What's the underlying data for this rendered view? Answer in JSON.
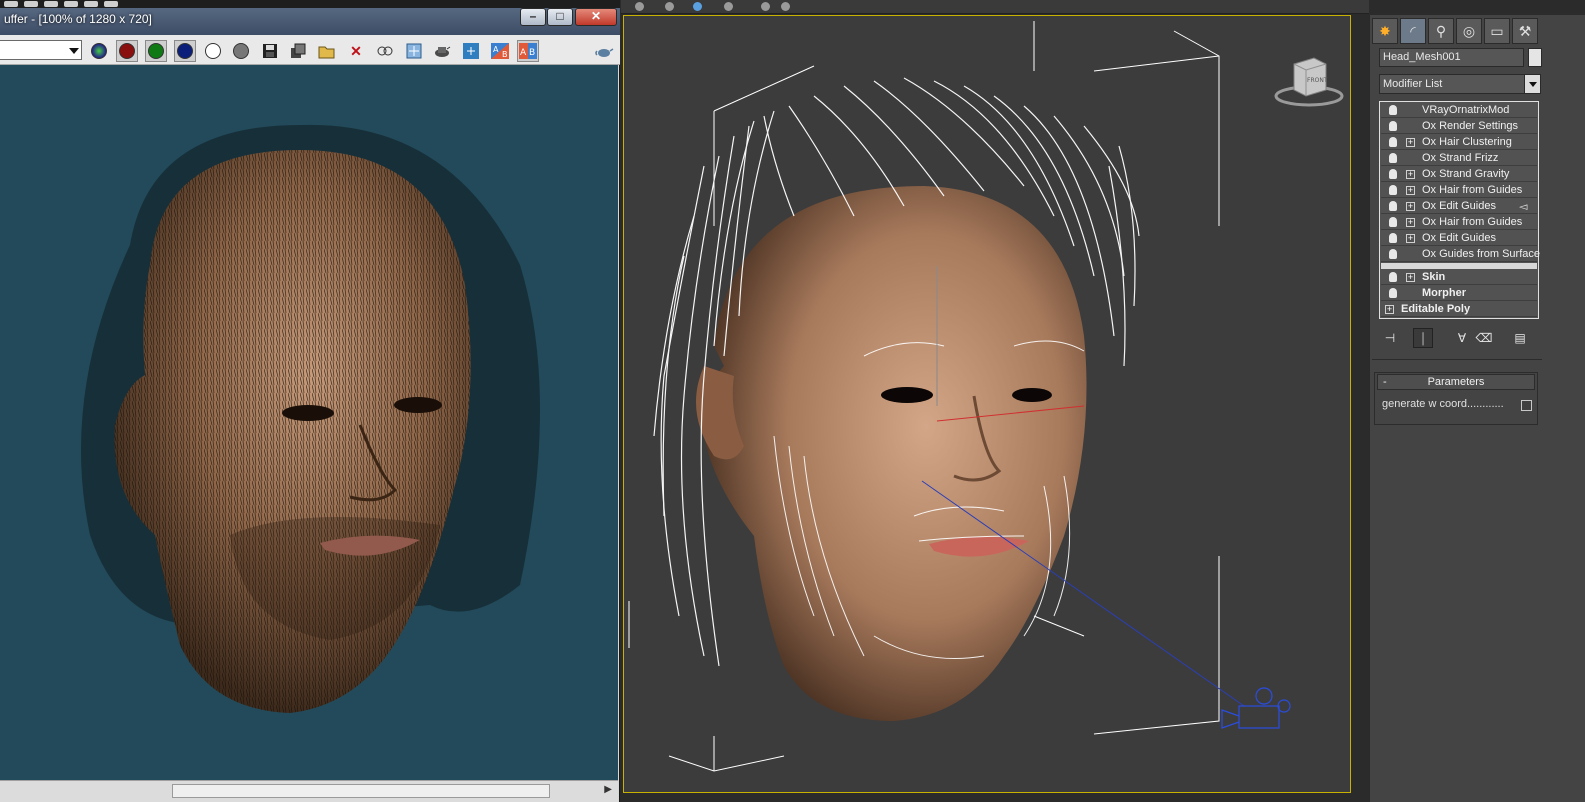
{
  "vfb": {
    "title": "uffer - [100% of 1280 x 720]",
    "window_buttons": {
      "minimize": "–",
      "maximize": "□",
      "close": "✕"
    },
    "toolbar": {
      "channel_value": "",
      "icons": [
        "red-channel-icon",
        "green-channel-icon",
        "blue-channel-icon",
        "alpha-channel-icon",
        "mono-icon",
        "save-icon",
        "duplicate-icon",
        "open-icon",
        "clear-icon",
        "track-mouse-icon",
        "region-render-icon",
        "render-icon",
        "lut-icon",
        "ab-compare-icon",
        "ab-toggle-icon",
        "teapot-icon"
      ]
    },
    "colors": {
      "background": "#224a5a"
    }
  },
  "viewport": {
    "viewcube_label": "FRONT",
    "colors": {
      "border": "#c9b100",
      "background": "#3c3c3c",
      "hair": "#ffffff",
      "skin": "#a87a5c"
    }
  },
  "command_panel": {
    "tabs": [
      "create-icon",
      "modify-icon",
      "hierarchy-icon",
      "motion-icon",
      "display-icon",
      "utilities-icon"
    ],
    "object_name": "Head_Mesh001",
    "modifier_list_label": "Modifier List",
    "stack": [
      {
        "label": "VRayOrnatrixMod",
        "expandable": false,
        "bold": false
      },
      {
        "label": "Ox Render Settings",
        "expandable": false,
        "bold": false
      },
      {
        "label": "Ox Hair Clustering",
        "expandable": true,
        "bold": false
      },
      {
        "label": "Ox Strand Frizz",
        "expandable": false,
        "bold": false
      },
      {
        "label": "Ox Strand Gravity",
        "expandable": true,
        "bold": false
      },
      {
        "label": "Ox Hair from Guides",
        "expandable": true,
        "bold": false
      },
      {
        "label": "Ox Edit Guides",
        "expandable": true,
        "bold": false,
        "edit_icon": true
      },
      {
        "label": "Ox Hair from Guides",
        "expandable": true,
        "bold": false
      },
      {
        "label": "Ox Edit Guides",
        "expandable": true,
        "bold": false
      },
      {
        "label": "Ox Guides from Surface",
        "expandable": false,
        "bold": false
      },
      {
        "label": "Skin",
        "expandable": true,
        "bold": true
      },
      {
        "label": "Morpher",
        "expandable": false,
        "bold": true
      },
      {
        "label": "Editable Poly",
        "expandable": true,
        "bold": true,
        "no_bulb": true
      }
    ],
    "stack_tools": [
      "pin-stack-icon",
      "show-end-result-icon",
      "make-unique-icon",
      "remove-modifier-icon",
      "configure-sets-icon"
    ],
    "parameters": {
      "title": "Parameters",
      "collapse": "-",
      "option_label": "generate w coord............",
      "option_checked": false
    }
  }
}
